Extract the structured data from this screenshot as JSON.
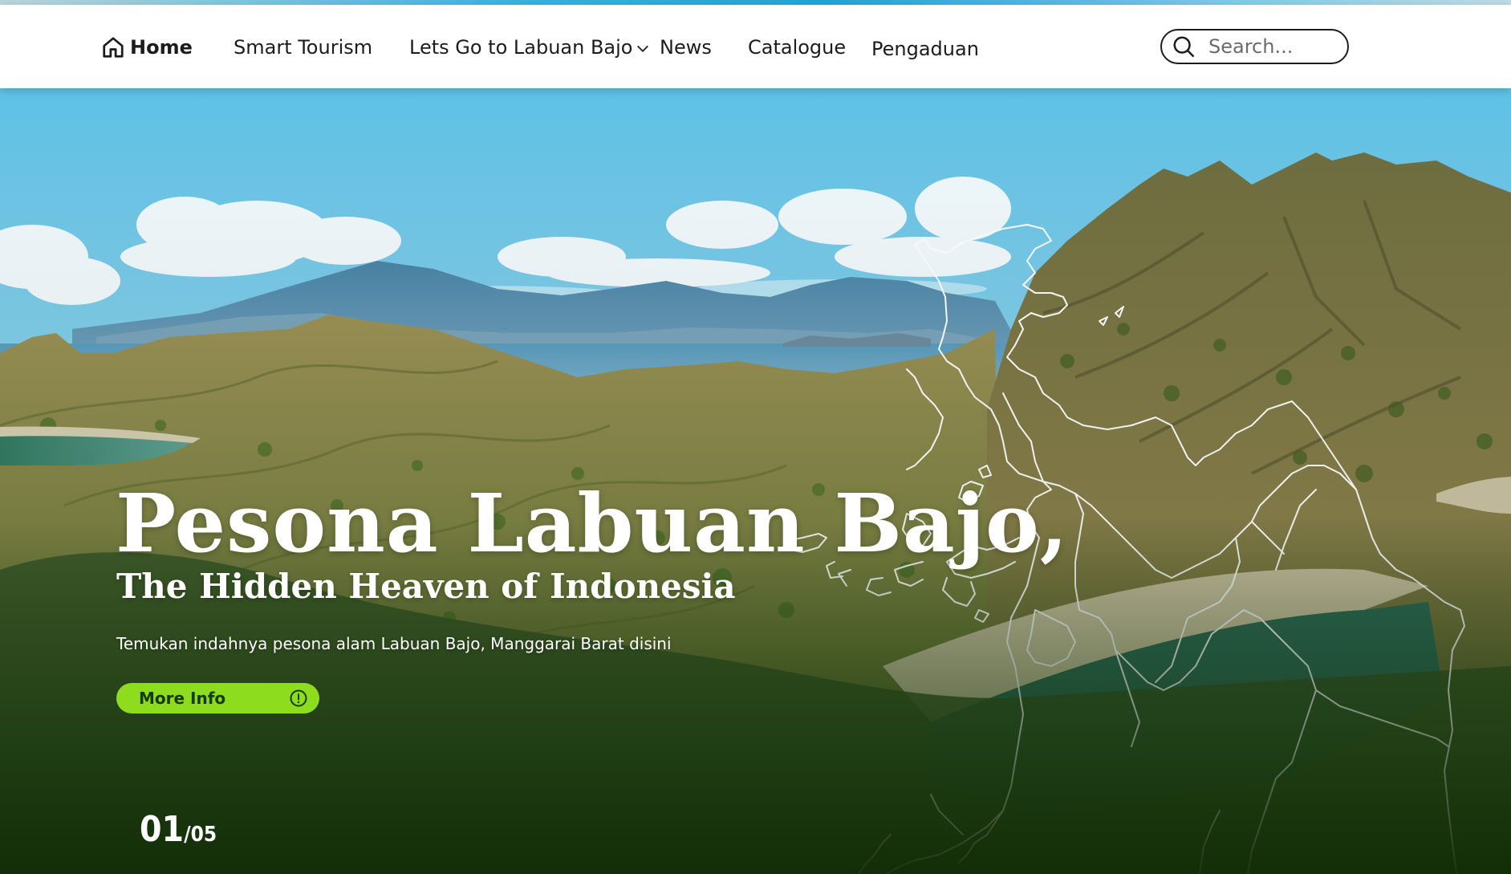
{
  "nav": {
    "items": [
      {
        "label": "Home"
      },
      {
        "label": "Smart Tourism"
      },
      {
        "label": "Lets Go to Labuan Bajo"
      },
      {
        "label": "News"
      },
      {
        "label": "Catalogue"
      },
      {
        "label": "Pengaduan"
      }
    ]
  },
  "search": {
    "placeholder": "Search..."
  },
  "hero": {
    "title": "Pesona Labuan Bajo,",
    "subtitle": "The Hidden Heaven of Indonesia",
    "description": "Temukan indahnya pesona alam Labuan Bajo, Manggarai Barat disini",
    "button_label": "More Info",
    "slide_current": "01",
    "slide_separator": "/",
    "slide_total": "05"
  },
  "colors": {
    "accent": "#8ddc1d",
    "nav_text": "#1c1c1c"
  },
  "icons": [
    "home-icon",
    "chevron-down-icon",
    "search-icon",
    "info-icon"
  ]
}
